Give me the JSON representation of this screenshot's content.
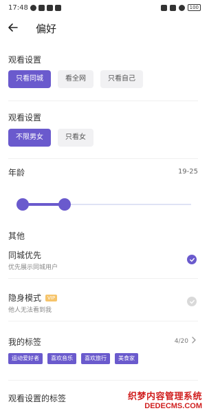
{
  "status_bar": {
    "time": "17:48",
    "battery": "100"
  },
  "header": {
    "title": "偏好"
  },
  "sections": {
    "field_one": {
      "label": "观看设置",
      "chips": [
        "只看同城",
        "看全网",
        "只看自己"
      ]
    },
    "field_two": {
      "label": "观看设置",
      "chips": [
        "不限男女",
        "只看女"
      ]
    },
    "age": {
      "label": "年龄",
      "value": "19-25",
      "range_min_fraction": 0.0,
      "range_max_fraction": 0.25
    },
    "other_label": "其他",
    "row_one": {
      "title": "同城优先",
      "subtitle": "优先展示同城用户",
      "checked": true
    },
    "row_two": {
      "title": "隐身模式",
      "badge": "VIP",
      "subtitle": "他人无法看到我",
      "checked": false
    },
    "tags": {
      "label": "我的标签",
      "count": "4/20",
      "items": [
        "运动爱好者",
        "喜欢音乐",
        "喜欢旅行",
        "美食家"
      ]
    },
    "last_label": "观看设置的标签"
  },
  "watermark": {
    "line1": "织梦内容管理系统",
    "line2": "DEDECMS.COM"
  },
  "colors": {
    "accent": "#6a5acd",
    "chip_bg": "#f1f1f3",
    "muted": "#d9d9d9"
  },
  "icons": {
    "back": "arrow-left-icon",
    "check": "check-icon",
    "chevron": "chevron-right-icon"
  }
}
